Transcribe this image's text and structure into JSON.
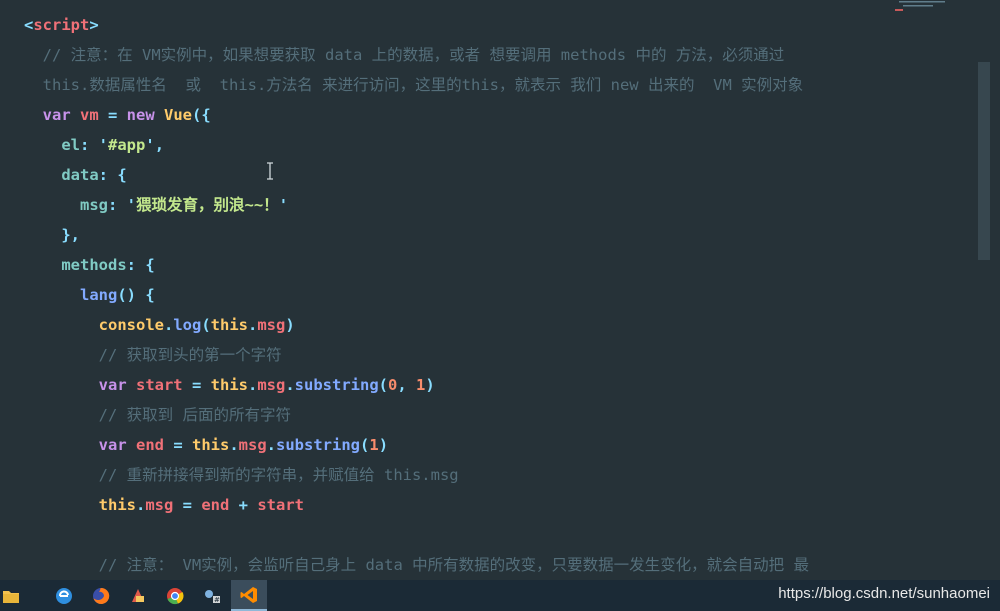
{
  "code": {
    "lines": [
      {
        "tokens": [
          {
            "text": "<",
            "type": "punct"
          },
          {
            "text": "script",
            "type": "tag"
          },
          {
            "text": ">",
            "type": "punct"
          }
        ]
      },
      {
        "tokens": [
          {
            "text": "  // 注意：在 VM实例中，如果想要获取 data 上的数据，或者 想要调用 methods 中的 方法，必须通过",
            "type": "comment"
          }
        ]
      },
      {
        "tokens": [
          {
            "text": "  this.数据属性名  或  this.方法名 来进行访问，这里的this，就表示 我们 new 出来的  VM 实例对象",
            "type": "comment"
          }
        ]
      },
      {
        "tokens": [
          {
            "text": "  var ",
            "type": "keyword"
          },
          {
            "text": "vm",
            "type": "var"
          },
          {
            "text": " = ",
            "type": "op"
          },
          {
            "text": "new ",
            "type": "keyword"
          },
          {
            "text": "Vue",
            "type": "class"
          },
          {
            "text": "({",
            "type": "punct"
          }
        ]
      },
      {
        "tokens": [
          {
            "text": "    el",
            "type": "prop"
          },
          {
            "text": ": ",
            "type": "punct"
          },
          {
            "text": "'",
            "type": "punct"
          },
          {
            "text": "#app",
            "type": "string"
          },
          {
            "text": "'",
            "type": "punct"
          },
          {
            "text": ",",
            "type": "punct"
          }
        ]
      },
      {
        "tokens": [
          {
            "text": "    data",
            "type": "prop"
          },
          {
            "text": ": {",
            "type": "punct"
          }
        ]
      },
      {
        "tokens": [
          {
            "text": "      msg",
            "type": "prop"
          },
          {
            "text": ": ",
            "type": "punct"
          },
          {
            "text": "'",
            "type": "punct"
          },
          {
            "text": "猥琐发育，别浪~~！",
            "type": "string"
          },
          {
            "text": "'",
            "type": "punct"
          }
        ]
      },
      {
        "tokens": [
          {
            "text": "    },",
            "type": "punct"
          }
        ]
      },
      {
        "tokens": [
          {
            "text": "    methods",
            "type": "prop"
          },
          {
            "text": ": {",
            "type": "punct"
          }
        ]
      },
      {
        "tokens": [
          {
            "text": "      lang",
            "type": "func"
          },
          {
            "text": "() {",
            "type": "punct"
          }
        ]
      },
      {
        "tokens": [
          {
            "text": "        console",
            "type": "obj"
          },
          {
            "text": ".",
            "type": "punct"
          },
          {
            "text": "log",
            "type": "func"
          },
          {
            "text": "(",
            "type": "punct"
          },
          {
            "text": "this",
            "type": "this"
          },
          {
            "text": ".",
            "type": "punct"
          },
          {
            "text": "msg",
            "type": "member"
          },
          {
            "text": ")",
            "type": "punct"
          }
        ]
      },
      {
        "tokens": [
          {
            "text": "        // 获取到头的第一个字符",
            "type": "comment"
          }
        ]
      },
      {
        "tokens": [
          {
            "text": "        var ",
            "type": "keyword"
          },
          {
            "text": "start",
            "type": "var"
          },
          {
            "text": " = ",
            "type": "op"
          },
          {
            "text": "this",
            "type": "this"
          },
          {
            "text": ".",
            "type": "punct"
          },
          {
            "text": "msg",
            "type": "member"
          },
          {
            "text": ".",
            "type": "punct"
          },
          {
            "text": "substring",
            "type": "func"
          },
          {
            "text": "(",
            "type": "punct"
          },
          {
            "text": "0",
            "type": "number"
          },
          {
            "text": ", ",
            "type": "punct"
          },
          {
            "text": "1",
            "type": "number"
          },
          {
            "text": ")",
            "type": "punct"
          }
        ]
      },
      {
        "tokens": [
          {
            "text": "        // 获取到 后面的所有字符",
            "type": "comment"
          }
        ]
      },
      {
        "tokens": [
          {
            "text": "        var ",
            "type": "keyword"
          },
          {
            "text": "end",
            "type": "var"
          },
          {
            "text": " = ",
            "type": "op"
          },
          {
            "text": "this",
            "type": "this"
          },
          {
            "text": ".",
            "type": "punct"
          },
          {
            "text": "msg",
            "type": "member"
          },
          {
            "text": ".",
            "type": "punct"
          },
          {
            "text": "substring",
            "type": "func"
          },
          {
            "text": "(",
            "type": "punct"
          },
          {
            "text": "1",
            "type": "number"
          },
          {
            "text": ")",
            "type": "punct"
          }
        ]
      },
      {
        "tokens": [
          {
            "text": "        // 重新拼接得到新的字符串，并赋值给 this.msg",
            "type": "comment"
          }
        ]
      },
      {
        "tokens": [
          {
            "text": "        this",
            "type": "this"
          },
          {
            "text": ".",
            "type": "punct"
          },
          {
            "text": "msg",
            "type": "member"
          },
          {
            "text": " = ",
            "type": "op"
          },
          {
            "text": "end",
            "type": "var"
          },
          {
            "text": " + ",
            "type": "op"
          },
          {
            "text": "start",
            "type": "var"
          }
        ]
      },
      {
        "tokens": []
      },
      {
        "tokens": [
          {
            "text": "        // 注意： VM实例，会监听自己身上 data 中所有数据的改变，只要数据一发生变化，就会自动把 最",
            "type": "comment"
          }
        ]
      }
    ]
  },
  "taskbar": {
    "items": [
      {
        "icon": "file-explorer-icon",
        "color": "#f2c14e",
        "active": false
      },
      {
        "icon": "ie-edge-icon",
        "color": "#2f8fe0",
        "active": false
      },
      {
        "icon": "firefox-icon",
        "color": "#ff7a1a",
        "active": false
      },
      {
        "icon": "app-red-icon",
        "color": "#e05a4a",
        "active": false
      },
      {
        "icon": "chrome-icon",
        "color": "#4caf50",
        "active": false
      },
      {
        "icon": "dev-tool-icon",
        "color": "#7fb2e0",
        "active": false
      },
      {
        "icon": "vscode-icon",
        "color": "#ff8c00",
        "active": true
      }
    ]
  },
  "watermark": "https://blog.csdn.net/sunhaomei"
}
